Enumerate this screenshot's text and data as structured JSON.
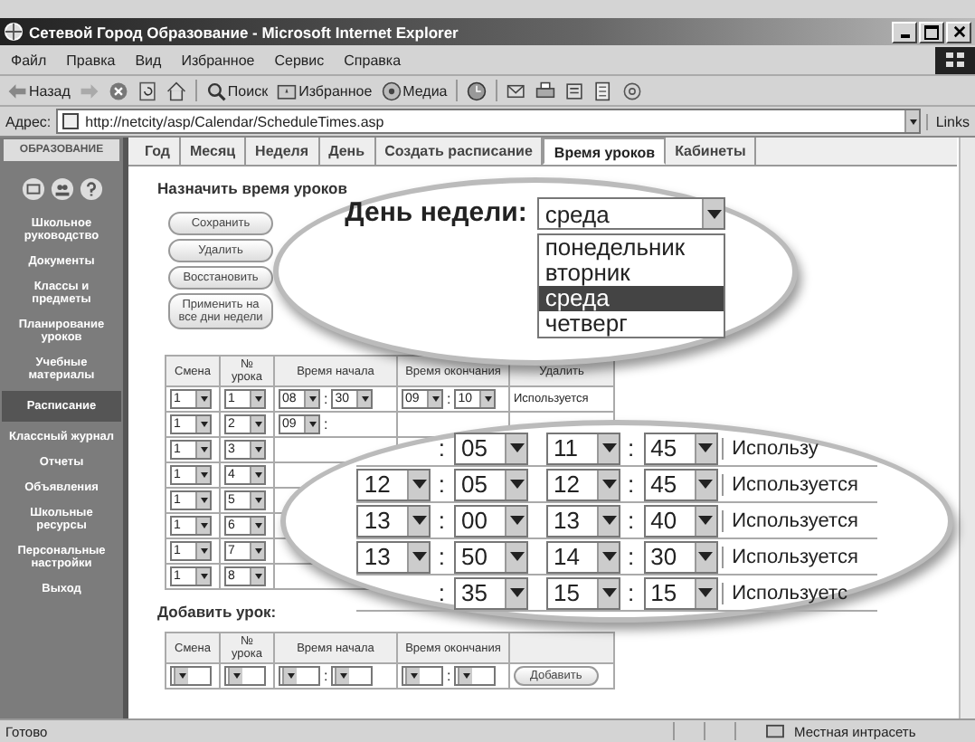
{
  "window": {
    "title": "Сетевой Город Образование - Microsoft Internet Explorer"
  },
  "menu": [
    "Файл",
    "Правка",
    "Вид",
    "Избранное",
    "Сервис",
    "Справка"
  ],
  "toolbar": [
    {
      "kind": "back",
      "label": "Назад"
    },
    {
      "kind": "forward"
    },
    {
      "kind": "stop"
    },
    {
      "kind": "refresh"
    },
    {
      "kind": "home"
    },
    {
      "kind": "search",
      "label": "Поиск"
    },
    {
      "kind": "favorites",
      "label": "Избранное"
    },
    {
      "kind": "media",
      "label": "Медиа"
    },
    {
      "kind": "history"
    },
    {
      "kind": "mail"
    },
    {
      "kind": "print"
    },
    {
      "kind": "edit"
    },
    {
      "kind": "discuss"
    },
    {
      "kind": "messenger"
    }
  ],
  "address": {
    "label": "Адрес:",
    "url": "http://netcity/asp/Calendar/ScheduleTimes.asp",
    "links": "Links"
  },
  "sidebar": {
    "logo": "ОБРАЗОВАНИЕ",
    "items": [
      {
        "label": "Школьное руководство",
        "selected": false
      },
      {
        "label": "Документы",
        "selected": false
      },
      {
        "label": "Классы и предметы",
        "selected": false
      },
      {
        "label": "Планирование уроков",
        "selected": false
      },
      {
        "label": "Учебные материалы",
        "selected": false
      },
      {
        "label": "Расписание",
        "selected": true
      },
      {
        "label": "Классный журнал",
        "selected": false
      },
      {
        "label": "Отчеты",
        "selected": false
      },
      {
        "label": "Объявления",
        "selected": false
      },
      {
        "label": "Школьные ресурсы",
        "selected": false
      },
      {
        "label": "Персональные настройки",
        "selected": false
      },
      {
        "label": "Выход",
        "selected": false
      }
    ]
  },
  "tabs": [
    {
      "label": "Год",
      "selected": false
    },
    {
      "label": "Месяц",
      "selected": false
    },
    {
      "label": "Неделя",
      "selected": false
    },
    {
      "label": "День",
      "selected": false
    },
    {
      "label": "Создать расписание",
      "selected": false
    },
    {
      "label": "Время уроков",
      "selected": true
    },
    {
      "label": "Кабинеты",
      "selected": false
    }
  ],
  "heading": "Назначить время уроков",
  "buttons": [
    "Сохранить",
    "Удалить",
    "Восстановить",
    "Применить на все дни недели"
  ],
  "schedule": {
    "columns": [
      "Смена",
      "№ урока",
      "Время начала",
      "Время окончания",
      "Удалить"
    ],
    "rows": [
      {
        "shift": "1",
        "number": "1",
        "start_h": "08",
        "start_sep": ":",
        "start_m": "30",
        "end_h": "09",
        "end_sep": ":",
        "end_m": "10",
        "status": "Используется"
      },
      {
        "shift": "1",
        "number": "2",
        "start_h": "09",
        "start_sep": ":"
      },
      {
        "shift": "1",
        "number": "3"
      },
      {
        "shift": "1",
        "number": "4"
      },
      {
        "shift": "1",
        "number": "5"
      },
      {
        "shift": "1",
        "number": "6"
      },
      {
        "shift": "1",
        "number": "7"
      },
      {
        "shift": "1",
        "number": "8"
      }
    ]
  },
  "day_zoom": {
    "label": "День недели:",
    "value": "среда",
    "options": [
      {
        "label": "понедельник",
        "selected": false
      },
      {
        "label": "вторник",
        "selected": false
      },
      {
        "label": "среда",
        "selected": true
      },
      {
        "label": "четверг",
        "selected": false
      }
    ]
  },
  "rows_zoom": [
    {
      "start_sep": ":",
      "start_m": "05",
      "end_h": "11",
      "end_sep": ":",
      "end_m": "45",
      "status": "Использу"
    },
    {
      "start_h": "12",
      "start_sep": ":",
      "start_m": "05",
      "end_h": "12",
      "end_sep": ":",
      "end_m": "45",
      "status": "Используется"
    },
    {
      "start_h": "13",
      "start_sep": ":",
      "start_m": "00",
      "end_h": "13",
      "end_sep": ":",
      "end_m": "40",
      "status": "Используется"
    },
    {
      "start_h": "13",
      "start_sep": ":",
      "start_m": "50",
      "end_h": "14",
      "end_sep": ":",
      "end_m": "30",
      "status": "Используется"
    },
    {
      "start_sep": ":",
      "start_m": "35",
      "end_h": "15",
      "end_sep": ":",
      "end_m": "15",
      "status": "Используетс"
    }
  ],
  "add": {
    "title": "Добавить урок:",
    "columns": [
      "Смена",
      "№ урока",
      "Время начала",
      "Время окончания"
    ],
    "start_sep": ":",
    "end_sep": ":",
    "button": "Добавить"
  },
  "status_bar": {
    "text": "Готово",
    "zone": "Местная интрасеть"
  }
}
